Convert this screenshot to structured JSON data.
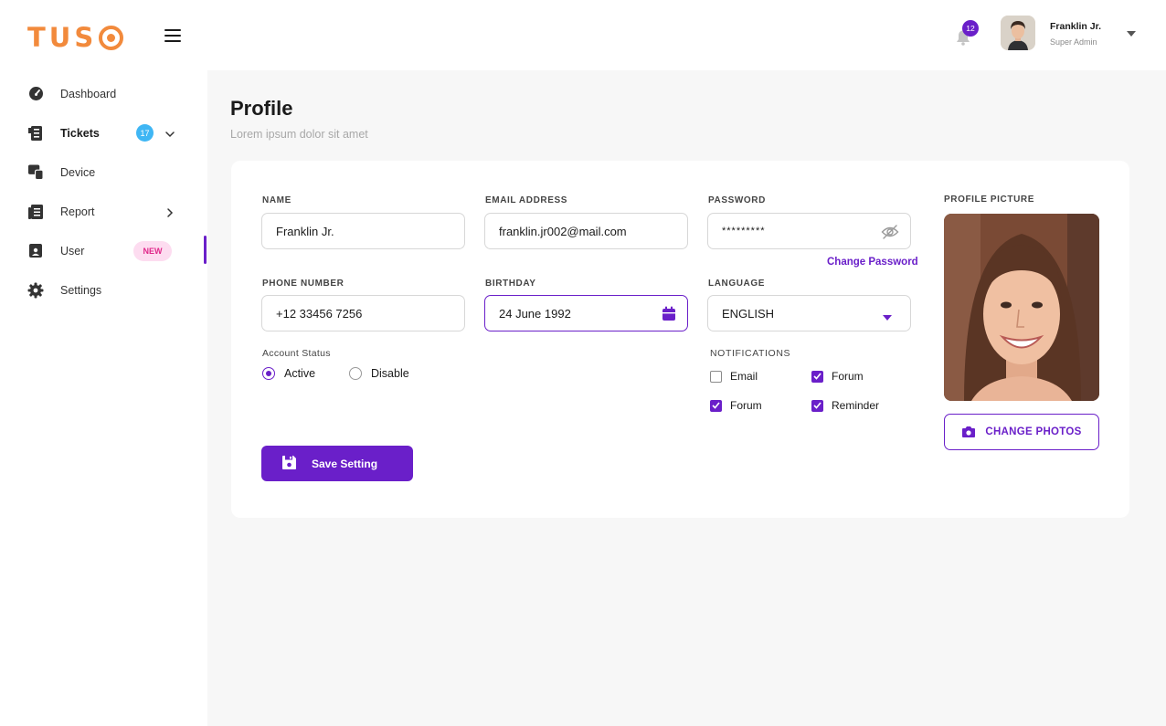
{
  "app": {
    "logo_text": "TUS"
  },
  "colors": {
    "accent": "#6a1fc9",
    "logo": "#f28a3c",
    "badge_blue": "#3fb6f4",
    "badge_new_bg": "#fddcf0",
    "badge_new_text": "#e0288a"
  },
  "sidebar": {
    "items": [
      {
        "label": "Dashboard",
        "icon": "dashboard-icon"
      },
      {
        "label": "Tickets",
        "icon": "tickets-icon",
        "badge": "17"
      },
      {
        "label": "Device",
        "icon": "device-icon"
      },
      {
        "label": "Report",
        "icon": "report-icon"
      },
      {
        "label": "User",
        "icon": "user-icon",
        "badge": "NEW"
      },
      {
        "label": "Settings",
        "icon": "settings-icon"
      }
    ]
  },
  "header": {
    "notification_count": "12",
    "user_name": "Franklin Jr.",
    "user_role": "Super Admin"
  },
  "page": {
    "title": "Profile",
    "subtitle": "Lorem ipsum  dolor sit amet"
  },
  "form": {
    "name": {
      "label": "NAME",
      "value": "Franklin Jr."
    },
    "email": {
      "label": "EMAIL ADDRESS",
      "value": "franklin.jr002@mail.com"
    },
    "password": {
      "label": "PASSWORD",
      "value": "*********",
      "change_link": "Change Password"
    },
    "phone": {
      "label": "PHONE NUMBER",
      "value": "+12 33456 7256"
    },
    "birthday": {
      "label": "BIRTHDAY",
      "value": "24 June 1992"
    },
    "language": {
      "label": "LANGUAGE",
      "value": "ENGLISH"
    },
    "account_status": {
      "label": "Account Status",
      "options": [
        {
          "label": "Active",
          "selected": true
        },
        {
          "label": "Disable",
          "selected": false
        }
      ]
    },
    "notifications": {
      "label": "NOTIFICATIONS",
      "options": [
        {
          "label": "Email",
          "checked": false
        },
        {
          "label": "Forum",
          "checked": true
        },
        {
          "label": "Forum",
          "checked": true
        },
        {
          "label": "Reminder",
          "checked": true
        }
      ]
    },
    "save_label": "Save Setting"
  },
  "profile_picture": {
    "label": "PROFILE PICTURE",
    "change_label": "CHANGE PHOTOS"
  }
}
